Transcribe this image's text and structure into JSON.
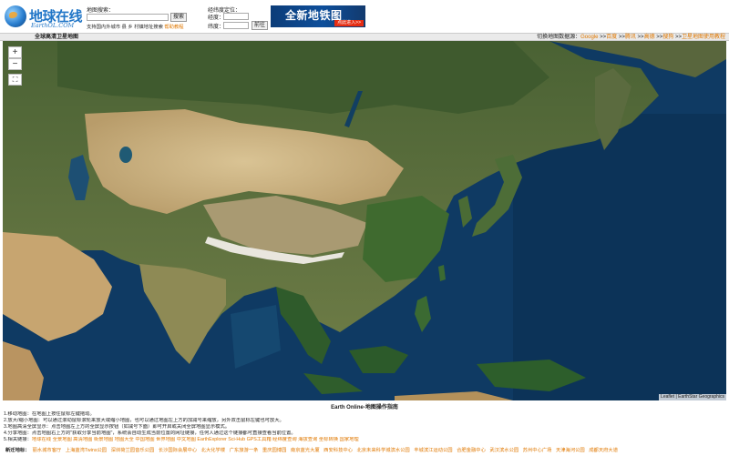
{
  "logo": {
    "cn": "地球在线",
    "en": "EarthOL.COM"
  },
  "search": {
    "label": "地图搜索：",
    "button": "搜索",
    "hint": "支持国内外城市 县 乡 村镇地址搜索",
    "hint_link": "帮助教程"
  },
  "coords": {
    "label": "经纬度定位：",
    "lng_label": "经度：",
    "lat_label": "纬度：",
    "button": "前往"
  },
  "banner": {
    "text": "全新地铁图",
    "cta": "点此进入>>"
  },
  "titlebar": {
    "left": "全球高清卫星地图",
    "right_prefix": "切换地图数据源：",
    "sources": [
      "Google",
      "百度",
      "腾讯",
      "高德",
      "搜狗"
    ],
    "extra_link": "卫星地图使用教程"
  },
  "map": {
    "zoom_in": "+",
    "zoom_out": "−",
    "fullscreen": "⛶",
    "attribution": "Leaflet | EarthStar Geographics",
    "colors": {
      "ocean": "#0f3a63",
      "land_green": "#4a6b35",
      "desert": "#c9b07e",
      "snow": "#e9e6de"
    }
  },
  "guide": {
    "title": "Earth Online-地图操作指南",
    "lines": [
      "1.移动地图：在地图上按住鼠标左键拖动。",
      "2.放大/缩小地图：可以通过滚动鼠标滚轮来放大或缩小地图，也可以通过地图左上方的加减号来缩放，另外双击鼠标左键也可放大。",
      "3.地图高清全屏显示：点击地图左上方的全屏显示按钮（如减号下面）即可开启或关闭全屏地图显示模式。",
      "4.分享地图：点击地图右上方的\"获取分享当前地图\"，系统会自动生成当前位置的网址链接，任何人通过这个链接都可直接查看当前位置。",
      "5.相关链接："
    ],
    "related_links": [
      "地球在线",
      "全景地图",
      "高清地图",
      "街景地图",
      "地图大全",
      "中国地图",
      "世界地图",
      "中文地图",
      "EarthExplorer",
      "Sci-Hub",
      "GPS工具箱",
      "经纬度查询",
      "海拔查询",
      "坐标转换",
      "国家地理"
    ]
  },
  "footer": {
    "label": "新迁地标：",
    "links": [
      "丽水城市客厅",
      "上海蓝湾Twins公园",
      "深圳荷兰园音乐公园",
      "长沙国际会展中心",
      "北大化学楼",
      "广东旅游一条",
      "重庆园博园",
      "南京蓝光大厦",
      "西安科技中心",
      "北京未来科学城滨水公园",
      "丰城滨江运动公园",
      "合肥金融中心",
      "武汉滨水公园",
      "苏州中心广场",
      "天津海河公园",
      "成都天府大道"
    ]
  }
}
